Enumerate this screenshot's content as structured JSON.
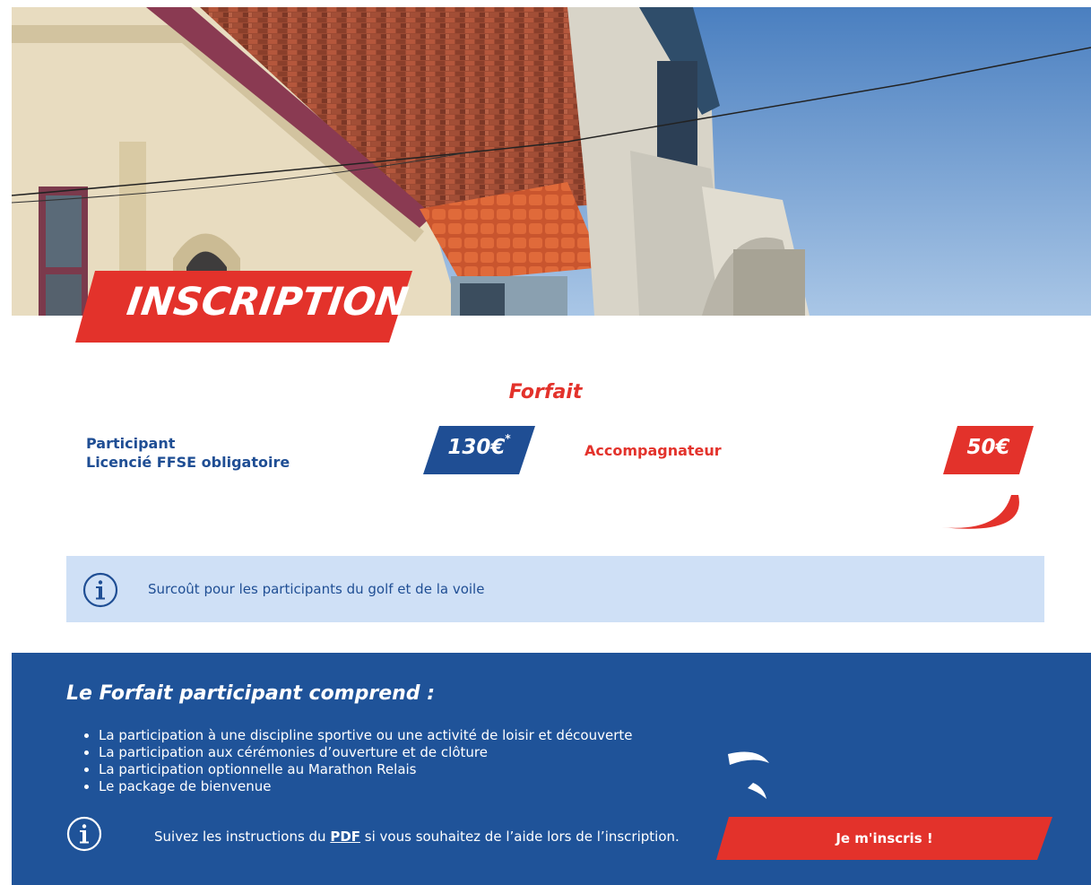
{
  "hero": {
    "title": "INSCRIPTION"
  },
  "forfait": {
    "heading": "Forfait",
    "participant": {
      "line1": "Participant",
      "line2": "Licencié FFSE obligatoire",
      "price": "130€",
      "price_mark": "*"
    },
    "accompagnateur": {
      "label": "Accompagnateur",
      "price": "50€"
    }
  },
  "info_box": {
    "text": "Surcoût pour les participants du golf et de la voile"
  },
  "footer": {
    "title": "Le Forfait participant comprend :",
    "items": [
      "La participation à une discipline sportive ou une activité de loisir et découverte",
      "La participation aux cérémonies d’ouverture et de clôture",
      "La participation optionnelle au Marathon Relais",
      "Le package de bienvenue"
    ],
    "help_before": "Suivez les instructions du ",
    "help_link": "PDF",
    "help_after": " si vous souhaitez de l’aide lors de l’inscription.",
    "button_label": "Je m'inscris !"
  },
  "colors": {
    "brand_red": "#e3322b",
    "brand_blue": "#1f5399",
    "info_bg": "#cfe0f6"
  }
}
